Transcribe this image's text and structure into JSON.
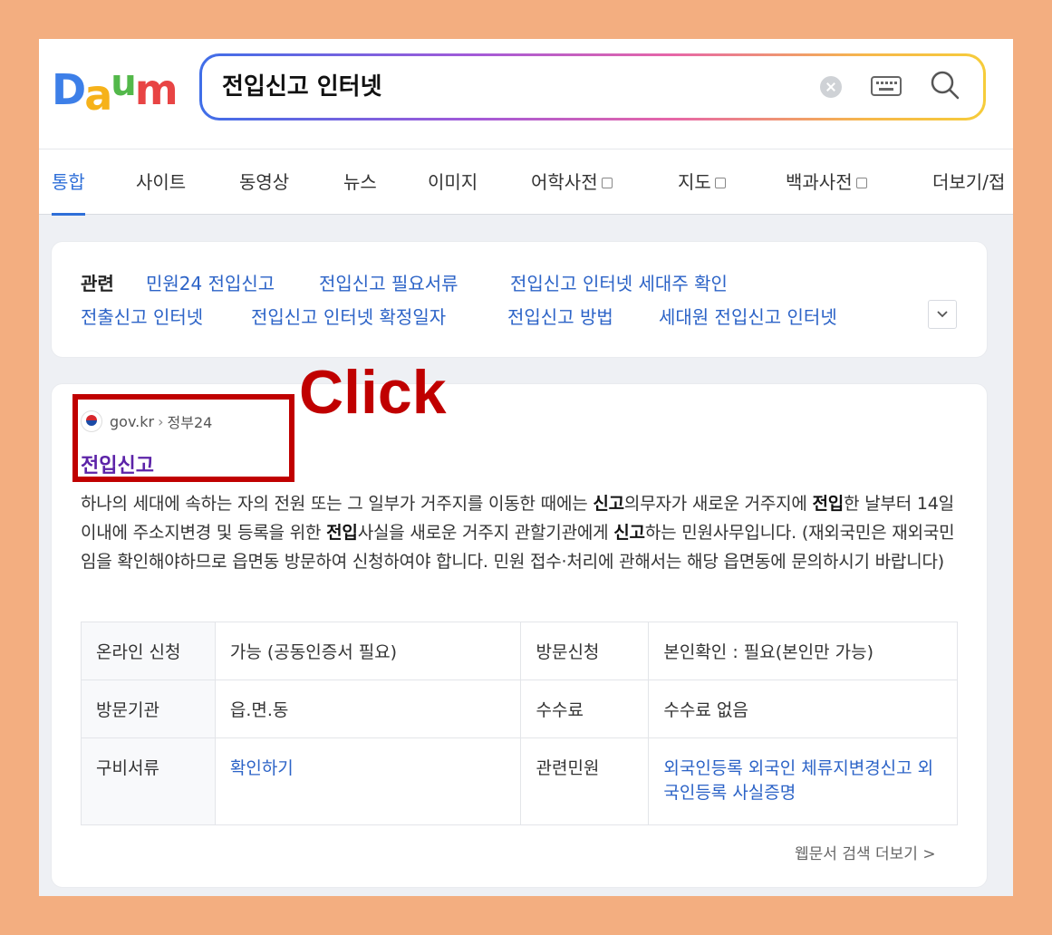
{
  "search": {
    "query": "전입신고 인터넷"
  },
  "logo": {
    "letters": [
      "D",
      "a",
      "u",
      "m"
    ]
  },
  "tabs": [
    {
      "label": "통합",
      "has_box": false
    },
    {
      "label": "사이트",
      "has_box": false
    },
    {
      "label": "동영상",
      "has_box": false
    },
    {
      "label": "뉴스",
      "has_box": false
    },
    {
      "label": "이미지",
      "has_box": false
    },
    {
      "label": "어학사전",
      "has_box": true
    },
    {
      "label": "지도",
      "has_box": true
    },
    {
      "label": "백과사전",
      "has_box": true
    },
    {
      "label": "더보기/접",
      "has_box": false
    }
  ],
  "related": {
    "label": "관련",
    "links": [
      "민원24 전입신고",
      "전입신고 필요서류",
      "전입신고 인터넷 세대주 확인",
      "전출신고 인터넷",
      "전입신고 인터넷 확정일자",
      "전입신고 방법",
      "세대원 전입신고 인터넷"
    ]
  },
  "result": {
    "domain": "gov.kr",
    "site": "정부24",
    "title": "전입신고",
    "desc": {
      "p1": "하나의 세대에 속하는 자의 전원 또는 그 일부가 거주지를 이동한 때에는 ",
      "b1": "신고",
      "p2": "의무자가 새로운 거주지에 ",
      "b2": "전입",
      "p3": "한 날부터 14일 이내에 주소지변경 및 등록을 위한 ",
      "b3": "전입",
      "p4": "사실을 새로운 거주지 관할기관에게 ",
      "b4": "신고",
      "p5": "하는 민원사무입니다. (재외국민은 재외국민임을 확인해야하므로 읍면동 방문하여 신청하여야 합니다. 민원 접수·처리에 관해서는 해당 읍면동에 문의하시기 바랍니다)"
    },
    "table": {
      "r1": {
        "k1": "온라인 신청",
        "v1": "가능 (공동인증서 필요)",
        "k2": "방문신청",
        "v2": "본인확인 : 필요(본인만 가능)"
      },
      "r2": {
        "k1": "방문기관",
        "v1": "읍.면.동",
        "k2": "수수료",
        "v2": "수수료 없음"
      },
      "r3": {
        "k1": "구비서류",
        "v1": "확인하기",
        "k2": "관련민원",
        "v2": "외국인등록 외국인 체류지변경신고 외국인등록 사실증명"
      }
    },
    "more": "웹문서 검색 더보기 >"
  },
  "annotation": {
    "label": "Click",
    "color": "#c00000"
  }
}
